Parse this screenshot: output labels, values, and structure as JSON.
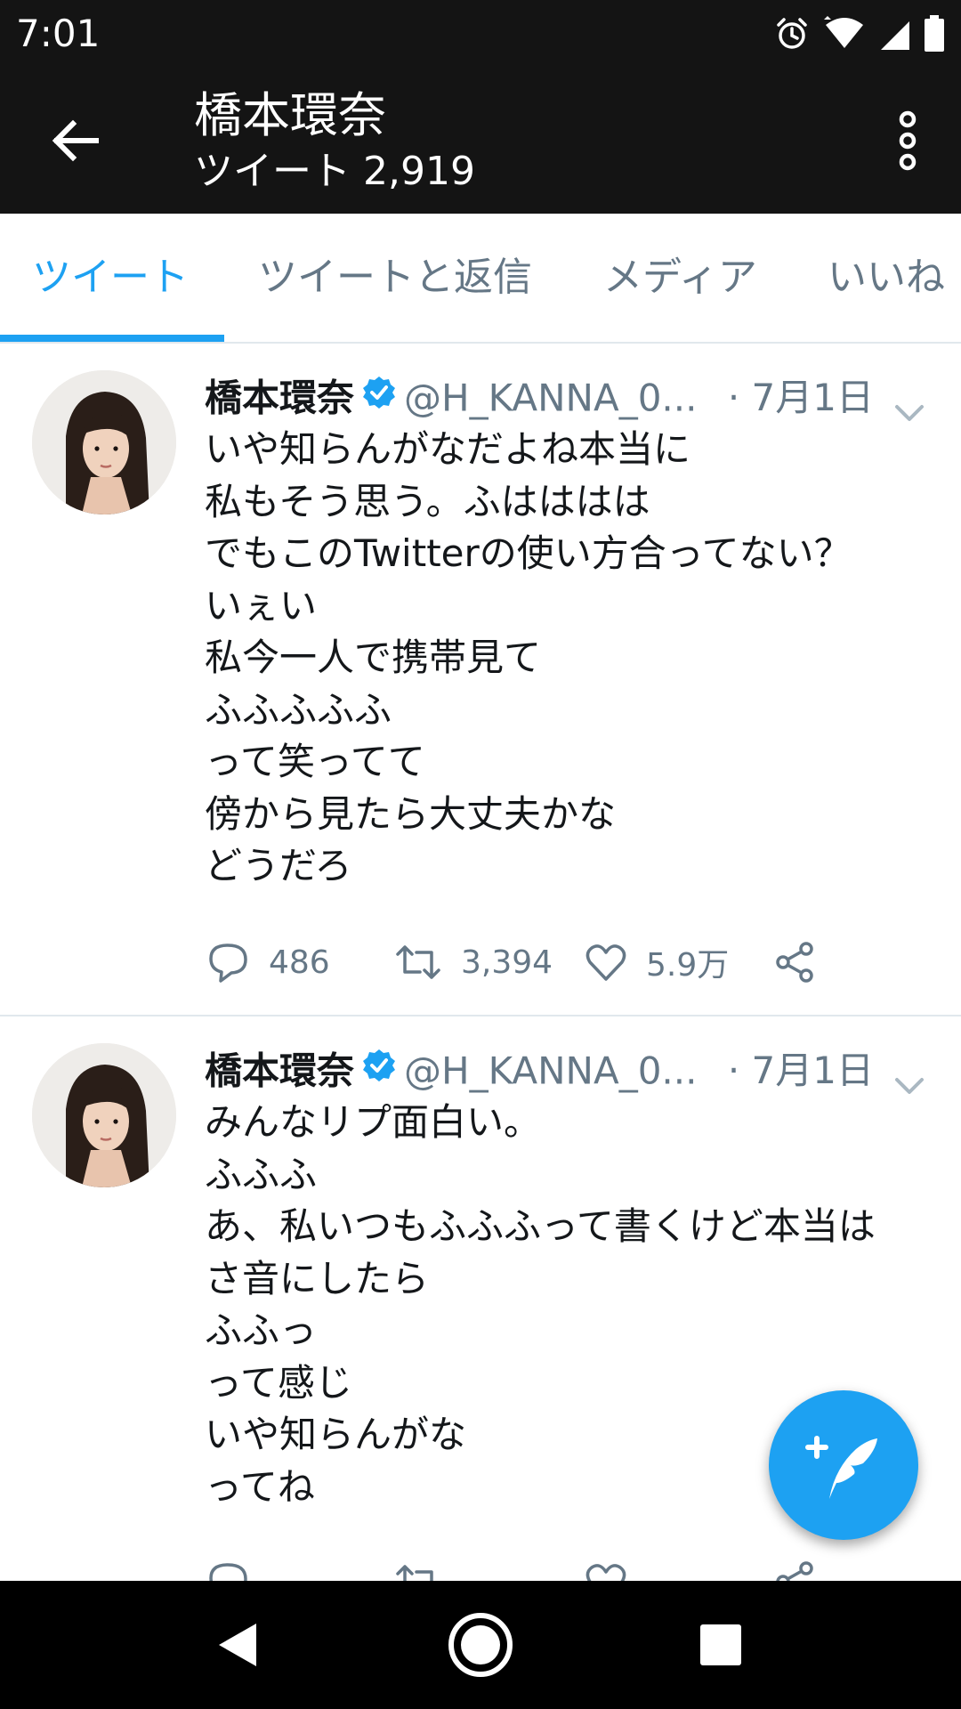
{
  "status_bar": {
    "time": "7:01"
  },
  "header": {
    "title": "橋本環奈",
    "subtitle": "ツイート 2,919"
  },
  "tabs": [
    {
      "label": "ツイート",
      "active": true
    },
    {
      "label": "ツイートと返信",
      "active": false
    },
    {
      "label": "メディア",
      "active": false
    },
    {
      "label": "いいね",
      "active": false
    }
  ],
  "tweets": [
    {
      "name": "橋本環奈",
      "handle": "@H_KANNA_0...",
      "date": "· 7月1日",
      "lines": [
        "いや知らんがなだよね本当に",
        "私もそう思う。ふはははは",
        "でもこのTwitterの使い方合ってない？",
        "いぇい",
        "私今一人で携帯見て",
        "ふふふふふ",
        "って笑ってて",
        "傍から見たら大丈夫かな",
        "どうだろ"
      ],
      "replies": "486",
      "retweets": "3,394",
      "likes": "5.9万"
    },
    {
      "name": "橋本環奈",
      "handle": "@H_KANNA_0...",
      "date": "· 7月1日",
      "lines": [
        "みんなリプ面白い。",
        "ふふふ",
        "あ、私いつもふふふって書くけど本当は",
        "さ音にしたら",
        "ふふっ",
        "って感じ",
        "いや知らんがな",
        "ってね"
      ],
      "replies": "",
      "retweets": "",
      "likes": ""
    }
  ],
  "colors": {
    "accent": "#1da1f2",
    "header_bg": "#141414",
    "secondary_text": "#657786"
  },
  "icons": [
    "back-arrow-icon",
    "more-vertical-icon",
    "verified-badge-icon",
    "chevron-down-icon",
    "reply-icon",
    "retweet-icon",
    "like-icon",
    "share-icon",
    "compose-icon",
    "nav-back-icon",
    "nav-home-icon",
    "nav-recents-icon"
  ]
}
